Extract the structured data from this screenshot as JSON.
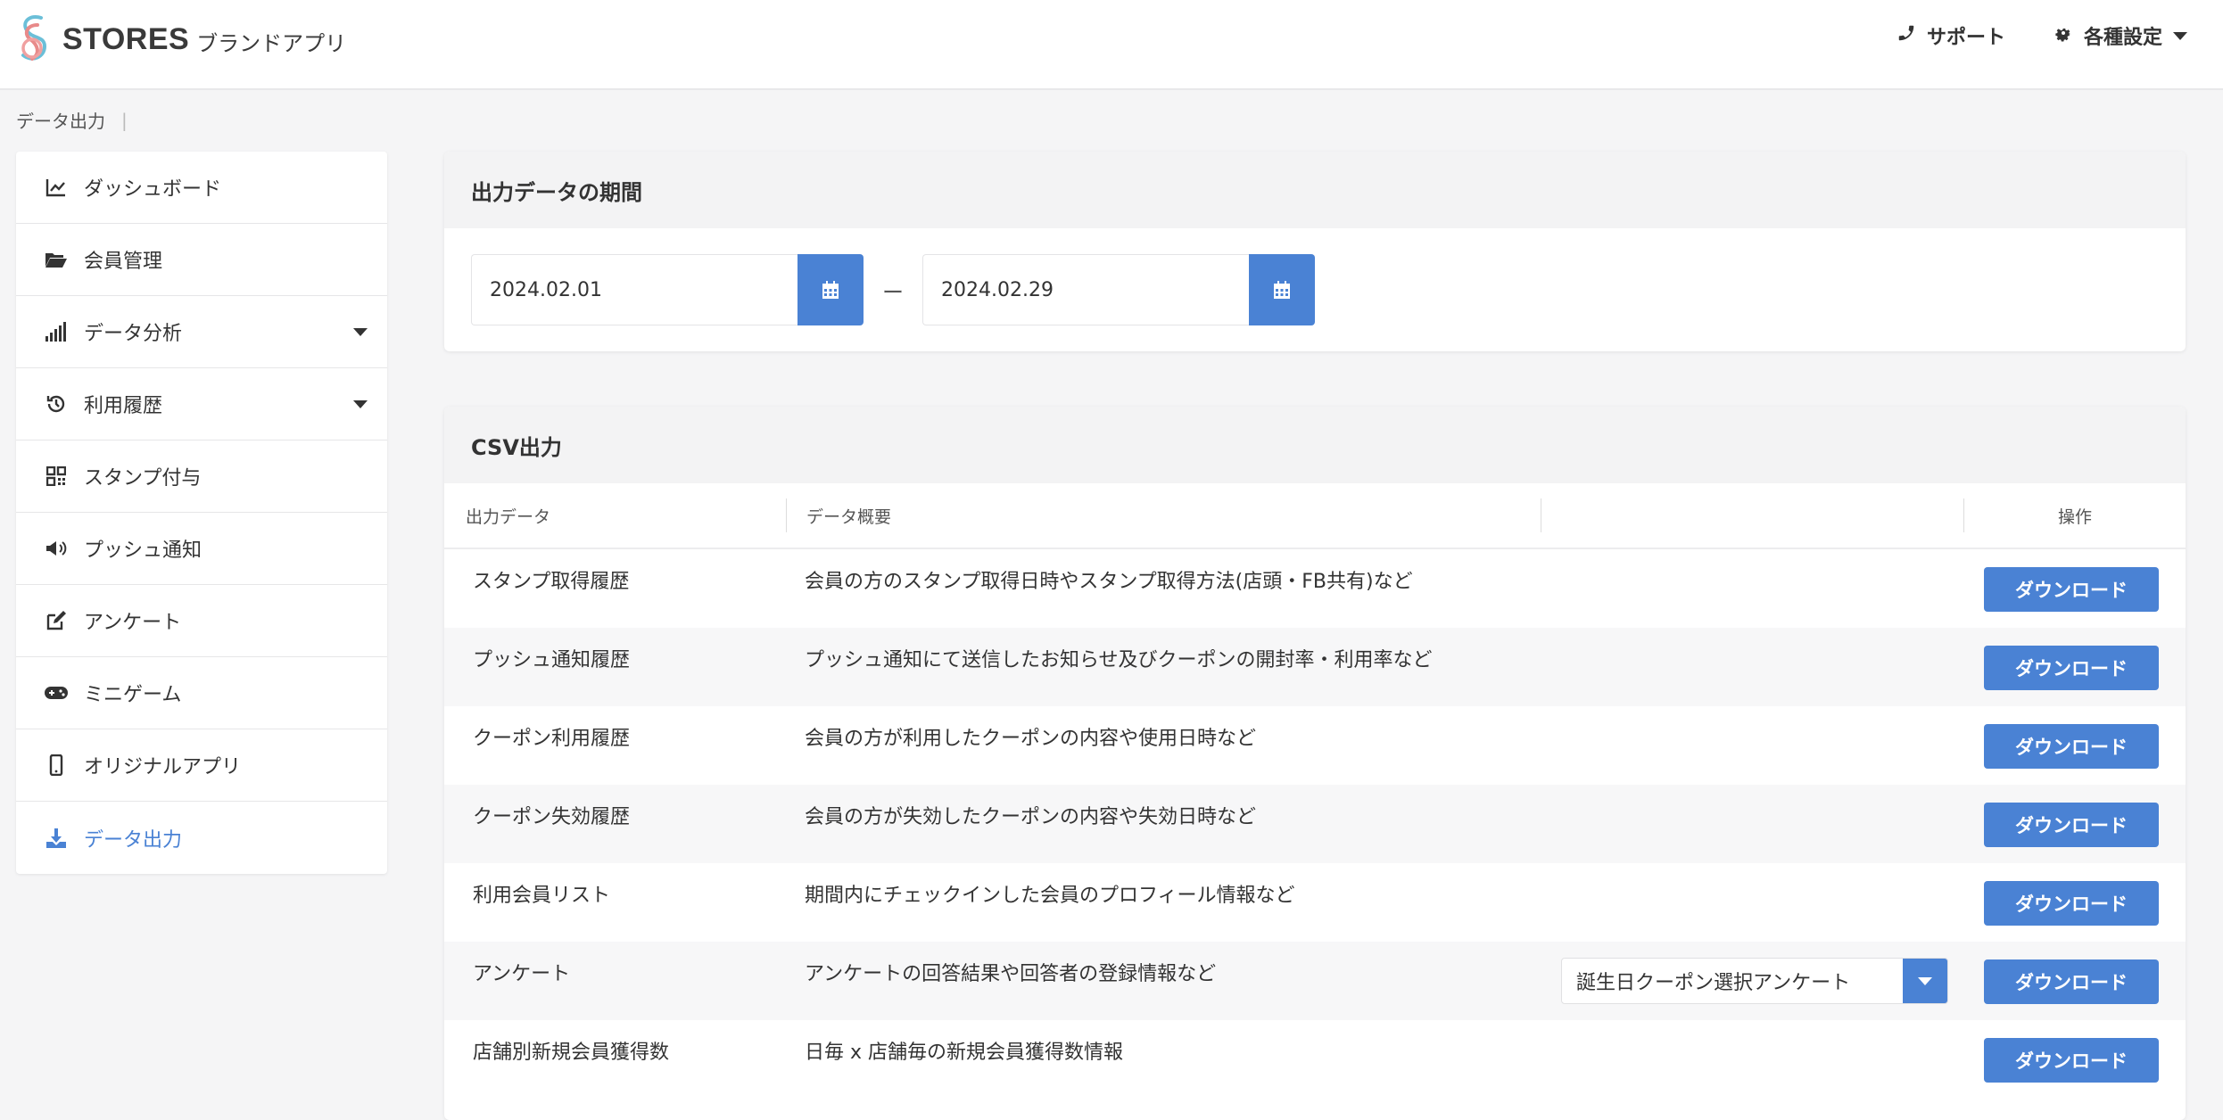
{
  "header": {
    "brand": "STORES",
    "brand_sub": "ブランドアプリ",
    "support": "サポート",
    "settings": "各種設定"
  },
  "breadcrumb": {
    "current": "データ出力",
    "separator": "|"
  },
  "sidebar": {
    "items": [
      {
        "label": "ダッシュボード",
        "icon": "chart-line-icon"
      },
      {
        "label": "会員管理",
        "icon": "folder-open-icon"
      },
      {
        "label": "データ分析",
        "icon": "signal-bars-icon"
      },
      {
        "label": "利用履歴",
        "icon": "history-icon"
      },
      {
        "label": "スタンプ付与",
        "icon": "qrcode-icon"
      },
      {
        "label": "プッシュ通知",
        "icon": "megaphone-icon"
      },
      {
        "label": "アンケート",
        "icon": "edit-icon"
      },
      {
        "label": "ミニゲーム",
        "icon": "gamepad-icon"
      },
      {
        "label": "オリジナルアプリ",
        "icon": "mobile-icon"
      },
      {
        "label": "データ出力",
        "icon": "download-icon"
      }
    ]
  },
  "period": {
    "title": "出力データの期間",
    "start": "2024.02.01",
    "end": "2024.02.29",
    "dash": "ー"
  },
  "csv": {
    "title": "CSV出力",
    "headers": [
      "出力データ",
      "データ概要",
      "",
      "操作"
    ],
    "download_label": "ダウンロード",
    "rows": [
      {
        "name": "スタンプ取得履歴",
        "desc": "会員の方のスタンプ取得日時やスタンプ取得方法(店頭・FB共有)など"
      },
      {
        "name": "プッシュ通知履歴",
        "desc": "プッシュ通知にて送信したお知らせ及びクーポンの開封率・利用率など"
      },
      {
        "name": "クーポン利用履歴",
        "desc": "会員の方が利用したクーポンの内容や使用日時など"
      },
      {
        "name": "クーポン失効履歴",
        "desc": "会員の方が失効したクーポンの内容や失効日時など"
      },
      {
        "name": "利用会員リスト",
        "desc": "期間内にチェックインした会員のプロフィール情報など"
      },
      {
        "name": "アンケート",
        "desc": "アンケートの回答結果や回答者の登録情報など"
      },
      {
        "name": "店舗別新規会員獲得数",
        "desc": "日毎 x 店舗毎の新規会員獲得数情報"
      }
    ],
    "survey_select": "誕生日クーポン選択アンケート"
  },
  "colors": {
    "accent": "#4a82d4",
    "header_bg": "#ffffff",
    "page_bg": "#f5f5f6"
  }
}
